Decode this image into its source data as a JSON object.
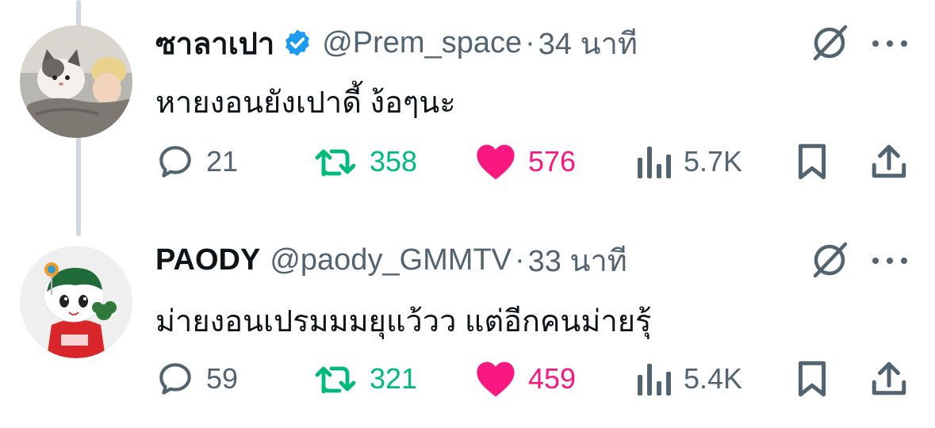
{
  "tweets": [
    {
      "display_name": "ซาลาเปา",
      "verified": true,
      "handle": "@Prem_space",
      "separator": "·",
      "time": "34 นาที",
      "text": "หายงอนยังเปาดี้ ง้อๆนะ",
      "replies": "21",
      "retweets": "358",
      "likes": "576",
      "views": "5.7K"
    },
    {
      "display_name": "PAODY",
      "verified": false,
      "handle": "@paody_GMMTV",
      "separator": "·",
      "time": "33 นาที",
      "text": "ม่ายงอนเปรมมมยุแว้วว แต่อีกคนม่ายรุ้",
      "replies": "59",
      "retweets": "321",
      "likes": "459",
      "views": "5.4K"
    }
  ],
  "colors": {
    "verified": "#1d9bf0",
    "retweet": "#00ba7c",
    "like": "#f91880",
    "secondary": "#536471",
    "thread_line": "#cfd9de"
  },
  "icons": [
    "reply-icon",
    "retweet-icon",
    "heart-icon",
    "views-icon",
    "bookmark-icon",
    "share-icon",
    "grok-icon",
    "more-icon",
    "verified-badge-icon"
  ]
}
